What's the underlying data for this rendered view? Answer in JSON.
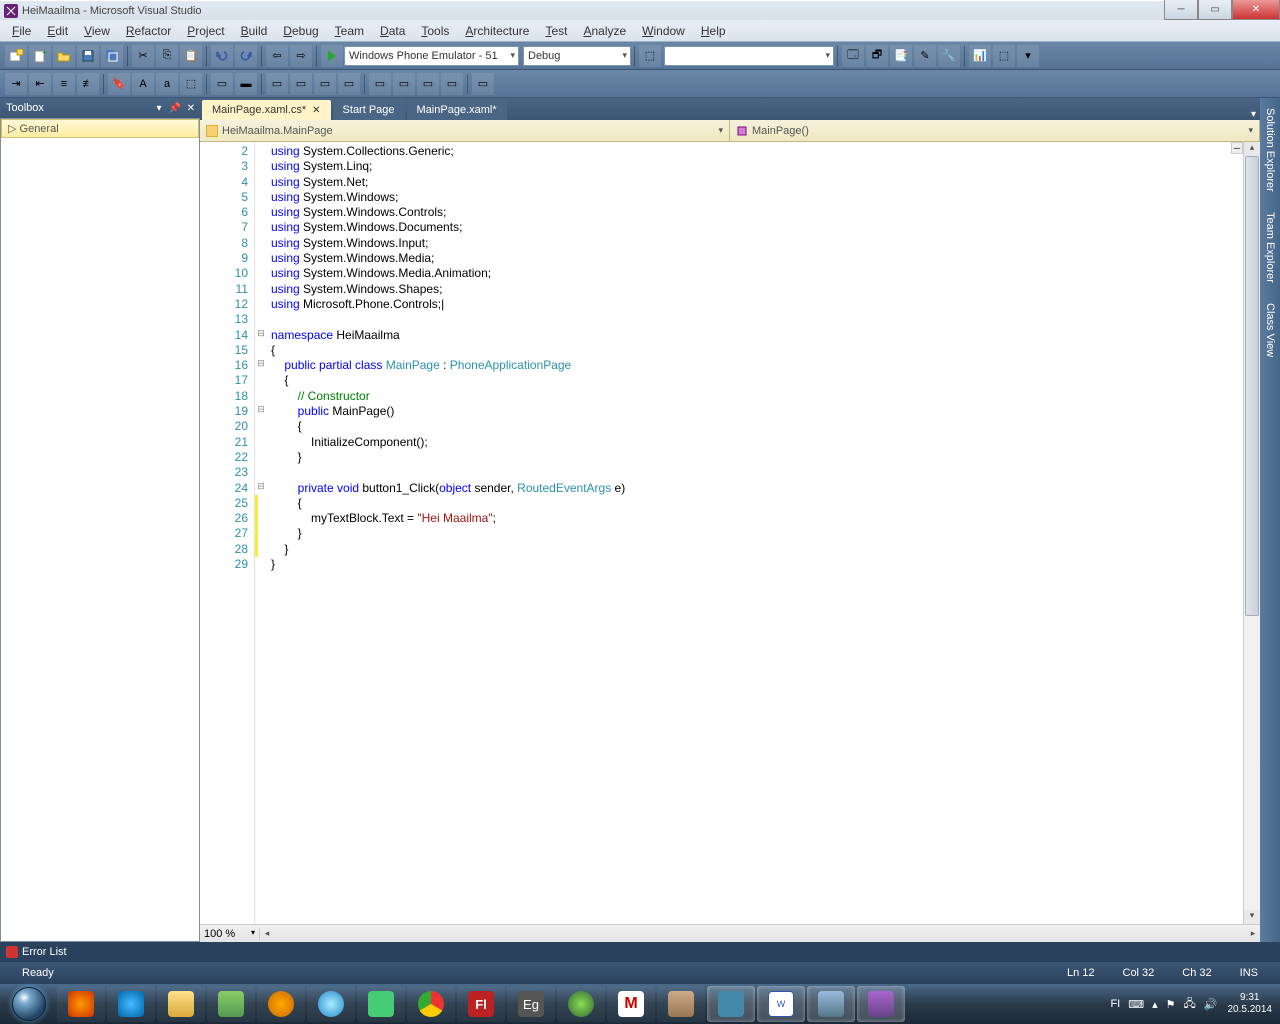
{
  "window": {
    "title": "HeiMaailma - Microsoft Visual Studio"
  },
  "menu": [
    "File",
    "Edit",
    "View",
    "Refactor",
    "Project",
    "Build",
    "Debug",
    "Team",
    "Data",
    "Tools",
    "Architecture",
    "Test",
    "Analyze",
    "Window",
    "Help"
  ],
  "toolbar1": {
    "platform": "Windows Phone Emulator - 51",
    "config": "Debug"
  },
  "toolbox": {
    "title": "Toolbox",
    "category": "General"
  },
  "tabs": [
    {
      "label": "MainPage.xaml.cs*",
      "active": true
    },
    {
      "label": "Start Page",
      "active": false
    },
    {
      "label": "MainPage.xaml*",
      "active": false
    }
  ],
  "nav": {
    "class": "HeiMaailma.MainPage",
    "member": "MainPage()"
  },
  "side": [
    "Solution Explorer",
    "Team Explorer",
    "Class View"
  ],
  "zoom": "100 %",
  "errorlist": "Error List",
  "status": {
    "ready": "Ready",
    "ln": "Ln 12",
    "col": "Col 32",
    "ch": "Ch 32",
    "ins": "INS"
  },
  "tray": {
    "lang": "FI",
    "time": "9:31",
    "date": "20.5.2014"
  },
  "code": {
    "start": 2,
    "lines": [
      {
        "n": 2,
        "t": "<span class='kw'>using</span> System.Collections.Generic;"
      },
      {
        "n": 3,
        "t": "<span class='kw'>using</span> System.Linq;"
      },
      {
        "n": 4,
        "t": "<span class='kw'>using</span> System.Net;"
      },
      {
        "n": 5,
        "t": "<span class='kw'>using</span> System.Windows;"
      },
      {
        "n": 6,
        "t": "<span class='kw'>using</span> System.Windows.Controls;"
      },
      {
        "n": 7,
        "t": "<span class='kw'>using</span> System.Windows.Documents;"
      },
      {
        "n": 8,
        "t": "<span class='kw'>using</span> System.Windows.Input;"
      },
      {
        "n": 9,
        "t": "<span class='kw'>using</span> System.Windows.Media;"
      },
      {
        "n": 10,
        "t": "<span class='kw'>using</span> System.Windows.Media.Animation;"
      },
      {
        "n": 11,
        "t": "<span class='kw'>using</span> System.Windows.Shapes;"
      },
      {
        "n": 12,
        "t": "<span class='kw'>using</span> Microsoft.Phone.Controls;|"
      },
      {
        "n": 13,
        "t": ""
      },
      {
        "n": 14,
        "f": "⊟",
        "t": "<span class='kw'>namespace</span> HeiMaailma"
      },
      {
        "n": 15,
        "t": "{"
      },
      {
        "n": 16,
        "f": "⊟",
        "t": "    <span class='kw'>public partial class</span> <span class='typ'>MainPage</span> : <span class='typ'>PhoneApplicationPage</span>"
      },
      {
        "n": 17,
        "t": "    {"
      },
      {
        "n": 18,
        "t": "        <span class='cmt'>// Constructor</span>"
      },
      {
        "n": 19,
        "f": "⊟",
        "t": "        <span class='kw'>public</span> MainPage()"
      },
      {
        "n": 20,
        "t": "        {"
      },
      {
        "n": 21,
        "t": "            InitializeComponent();"
      },
      {
        "n": 22,
        "t": "        }"
      },
      {
        "n": 23,
        "t": ""
      },
      {
        "n": 24,
        "f": "⊟",
        "t": "        <span class='kw'>private void</span> button1_Click(<span class='kw'>object</span> sender, <span class='typ'>RoutedEventArgs</span> e)"
      },
      {
        "n": 25,
        "t": "        {"
      },
      {
        "n": 26,
        "t": "            myTextBlock.Text = <span class='str'>\"Hei Maailma\"</span>;"
      },
      {
        "n": 27,
        "t": "        }"
      },
      {
        "n": 28,
        "t": "    }"
      },
      {
        "n": 29,
        "t": "}"
      }
    ]
  }
}
